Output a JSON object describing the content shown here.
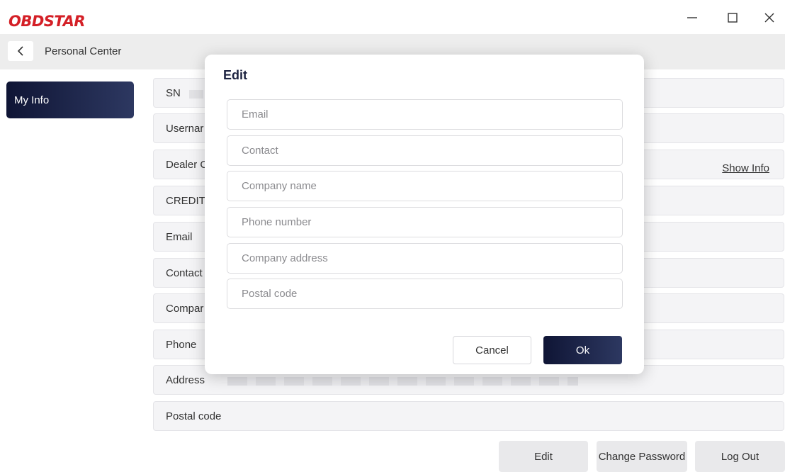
{
  "app": {
    "logo_text": "OBDSTAR",
    "brand_color": "#d41f26",
    "accent_color": "#1a2040"
  },
  "window_controls": {
    "minimize": "minimize-icon",
    "maximize": "maximize-icon",
    "close": "close-icon"
  },
  "header": {
    "back_icon": "chevron-left-icon",
    "title": "Personal Center"
  },
  "sidebar": {
    "items": [
      {
        "label": "My Info",
        "active": true
      }
    ]
  },
  "info": {
    "rows": [
      {
        "label": "SN"
      },
      {
        "label": "Usernar"
      },
      {
        "label": "Dealer C",
        "action": "Show Info"
      },
      {
        "label": "CREDIT"
      },
      {
        "label": "Email"
      },
      {
        "label": "Contact"
      },
      {
        "label": "Compar"
      },
      {
        "label": "Phone"
      },
      {
        "label": "Address"
      },
      {
        "label": "Postal code"
      }
    ]
  },
  "actions": {
    "edit": "Edit",
    "change_password": "Change Password",
    "log_out": "Log Out"
  },
  "dialog": {
    "title": "Edit",
    "fields": [
      {
        "placeholder": "Email",
        "value": ""
      },
      {
        "placeholder": "Contact",
        "value": ""
      },
      {
        "placeholder": "Company name",
        "value": ""
      },
      {
        "placeholder": "Phone number",
        "value": ""
      },
      {
        "placeholder": "Company address",
        "value": ""
      },
      {
        "placeholder": "Postal code",
        "value": ""
      }
    ],
    "cancel_label": "Cancel",
    "ok_label": "Ok"
  }
}
